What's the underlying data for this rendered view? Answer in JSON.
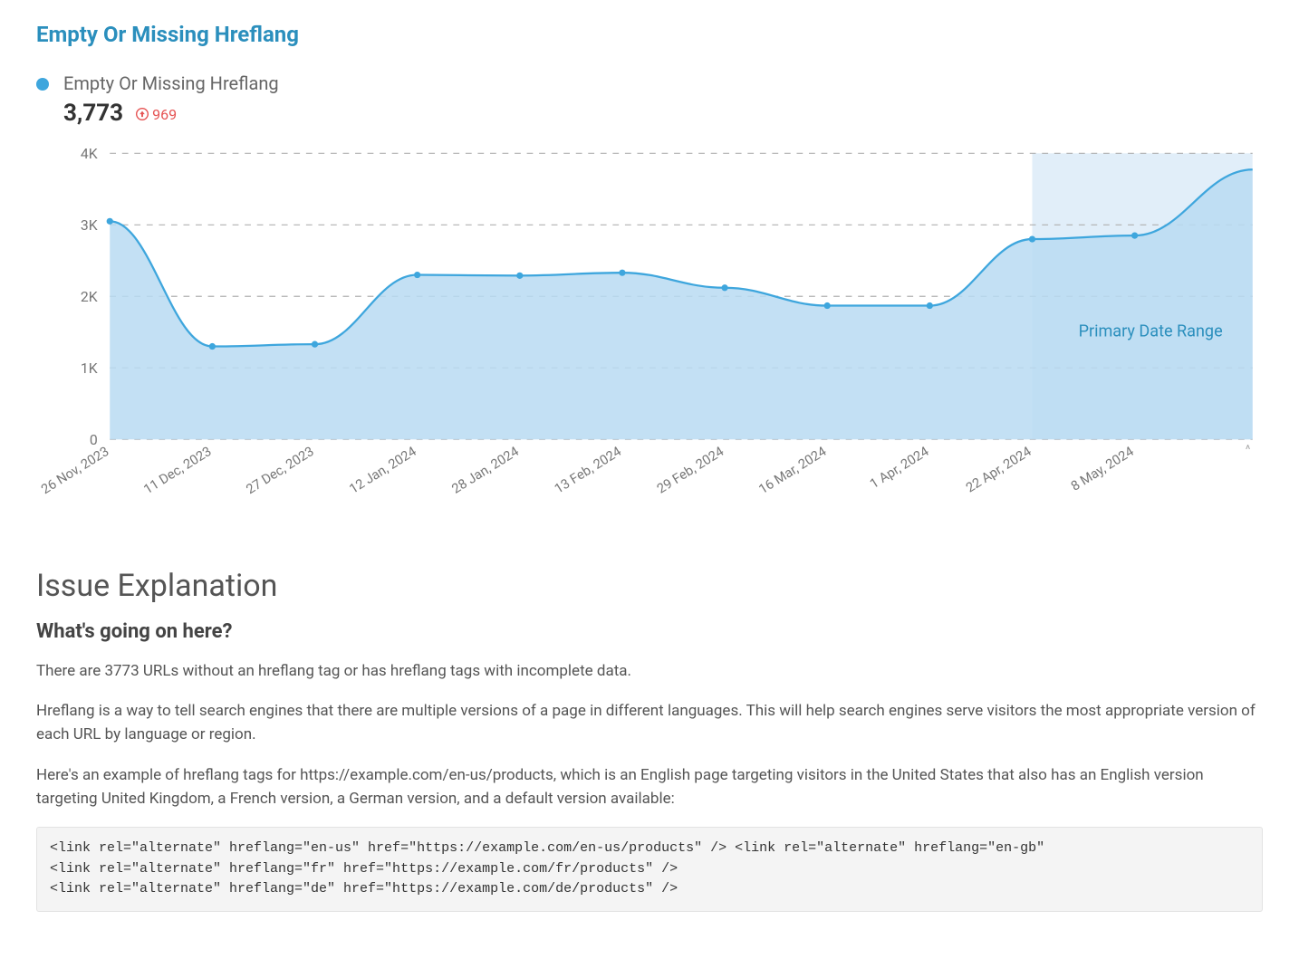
{
  "header": {
    "title_link": "Empty Or Missing Hreflang"
  },
  "metric": {
    "series_label": "Empty Or Missing Hreflang",
    "value": "3,773",
    "delta": "969",
    "delta_direction": "up",
    "dot_color": "#3ea6dd",
    "delta_color": "#e55353"
  },
  "chart_data": {
    "type": "area",
    "title": "",
    "xlabel": "",
    "ylabel": "",
    "ylim": [
      0,
      4000
    ],
    "y_ticks": [
      "0",
      "1K",
      "2K",
      "3K",
      "4K"
    ],
    "categories": [
      "26 Nov, 2023",
      "11 Dec, 2023",
      "27 Dec, 2023",
      "12 Jan, 2024",
      "28 Jan, 2024",
      "13 Feb, 2024",
      "29 Feb, 2024",
      "16 Mar, 2024",
      "1 Apr, 2024",
      "22 Apr, 2024",
      "8 May, 2024"
    ],
    "values": [
      3050,
      1300,
      1330,
      2300,
      2290,
      2330,
      2120,
      1870,
      1870,
      2800,
      2850
    ],
    "extra_points": {
      "x_beyond_last": true,
      "value": 3773
    },
    "annotations": [
      {
        "text": "Primary Date Range",
        "color": "#2b8fbd"
      }
    ],
    "highlight_band": {
      "from_category": "22 Apr, 2024",
      "to_end": true
    },
    "series_color": "#3ea6dd",
    "fill_color": "#b8dbf2",
    "grid": {
      "style": "dashed",
      "color": "#b0b0b0"
    }
  },
  "explanation": {
    "heading": "Issue Explanation",
    "subheading": "What's going on here?",
    "para1": "There are 3773 URLs without an hreflang tag or has hreflang tags with incomplete data.",
    "para2": "Hreflang is a way to tell search engines that there are multiple versions of a page in different languages. This will help search engines serve visitors the most appropriate version of each URL by language or region.",
    "para3": "Here's an example of hreflang tags for https://example.com/en-us/products, which is an English page targeting visitors in the United States that also has an English version targeting United Kingdom, a French version, a German version, and a default version available:",
    "code": "<link rel=\"alternate\" hreflang=\"en-us\" href=\"https://example.com/en-us/products\" /> <link rel=\"alternate\" hreflang=\"en-gb\"\n<link rel=\"alternate\" hreflang=\"fr\" href=\"https://example.com/fr/products\" />\n<link rel=\"alternate\" hreflang=\"de\" href=\"https://example.com/de/products\" />"
  }
}
